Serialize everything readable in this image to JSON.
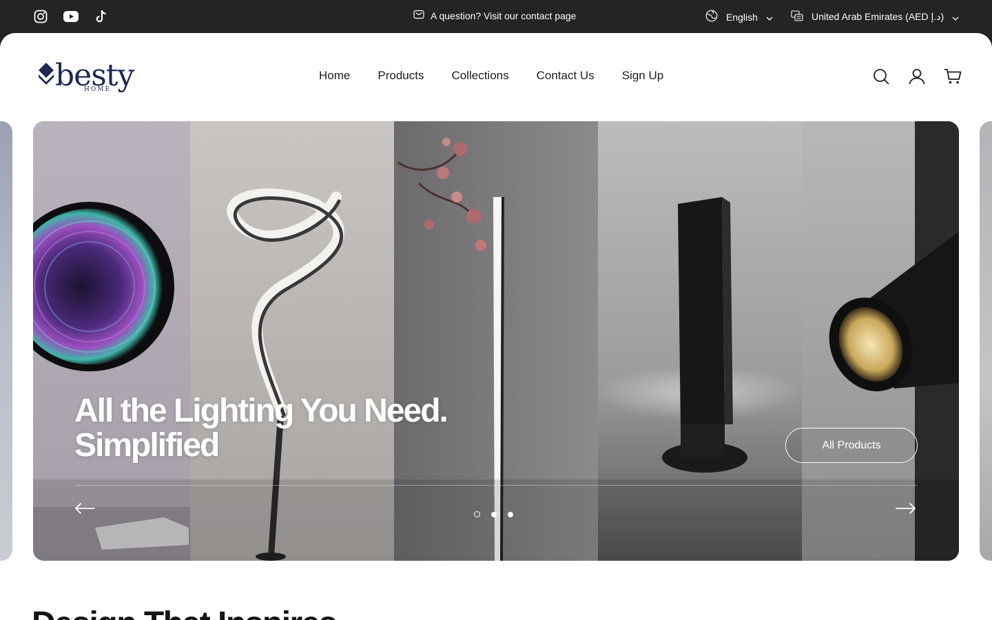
{
  "announcement": {
    "social": [
      {
        "name": "instagram-icon"
      },
      {
        "name": "youtube-icon"
      },
      {
        "name": "tiktok-icon"
      }
    ],
    "message": "A question? Visit our contact page",
    "language": "English",
    "country": "United Arab Emirates (AED د.إ)"
  },
  "header": {
    "logo_text": "besty",
    "logo_sub": "HOME",
    "nav": [
      {
        "label": "Home"
      },
      {
        "label": "Products"
      },
      {
        "label": "Collections"
      },
      {
        "label": "Contact Us"
      },
      {
        "label": "Sign Up"
      }
    ],
    "icons": [
      "search-icon",
      "account-icon",
      "cart-icon"
    ]
  },
  "hero": {
    "title_line1": "All the Lighting You Need.",
    "title_line2": "Simplified",
    "button_label": "All Products",
    "slide_count": 3,
    "active_slide": 1
  },
  "section": {
    "title": "Design That Inspires"
  },
  "colors": {
    "topbar": "#242424",
    "brand": "#1c2a52",
    "text": "#1c1c1c"
  }
}
